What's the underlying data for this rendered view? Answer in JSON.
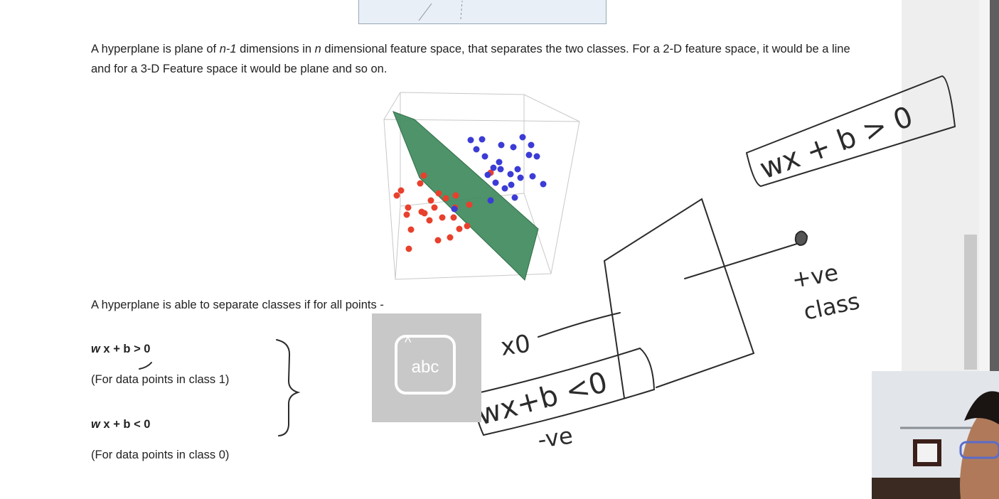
{
  "figure_top": {},
  "text": {
    "p1_a": "A hyperplane is plane of ",
    "p1_n1": "n-1",
    "p1_b": " dimensions in ",
    "p1_n": "n",
    "p1_c": " dimensional feature space, that separates the two classes. For a 2-D feature space, it would be a line and for a 3-D Feature space it would be plane and so on.",
    "p2": "A hyperplane is able to separate classes if for all points -",
    "eq1": "w x + b > 0",
    "class1": "(For data points in class 1)",
    "eq2": "w x + b < 0",
    "class0": "(For data points in class 0)"
  },
  "plot3d": {
    "colors": {
      "class_red": "#e8402c",
      "class_blue": "#3b3bd6",
      "plane": "#3f8a5c"
    }
  },
  "handwriting": {
    "box_top": "wx + b > 0",
    "plus_class": "+ve",
    "plus_class_2": "class",
    "x0": "x0",
    "box_bottom": "wx+b <0",
    "minus_class": "-ve",
    "ink_color": "#2b2b2b"
  },
  "handwriting_tool": {
    "label": "abc",
    "icon": "handwriting-input-icon"
  },
  "ui_colors": {
    "gutter": "#eeeeee",
    "scrollbar": "#5f5f5f"
  }
}
